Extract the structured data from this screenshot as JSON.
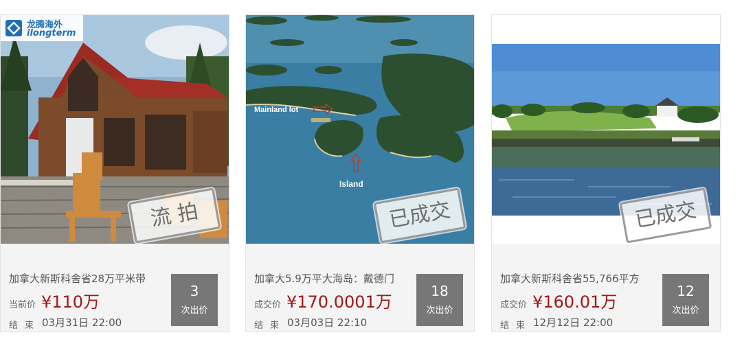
{
  "logo": {
    "cn": "龙腾海外",
    "en": "ilongterm"
  },
  "listings": [
    {
      "title": "加拿大新斯科舍省28万平米带",
      "price_label": "当前价",
      "price": "¥110万",
      "end_label": "结束",
      "end_time": "03月31日 22:00",
      "bid_count": "3",
      "bid_label": "次出价",
      "stamp": "流 拍"
    },
    {
      "title": "加拿大5.9万平大海岛：戴德门",
      "price_label": "成交价",
      "price": "¥170.0001万",
      "end_label": "结束",
      "end_time": "03月03日 22:10",
      "bid_count": "18",
      "bid_label": "次出价",
      "stamp": "已成交",
      "map_labels": {
        "mainland": "Mainland lot",
        "island": "Island"
      }
    },
    {
      "title": "加拿大新斯科舍省55,766平方",
      "price_label": "成交价",
      "price": "¥160.01万",
      "end_label": "结束",
      "end_time": "12月12日 22:00",
      "bid_count": "12",
      "bid_label": "次出价",
      "stamp": "已成交"
    }
  ],
  "colors": {
    "price": "#a01818",
    "bid_box": "#777777",
    "info_bg": "#f4f4f4"
  }
}
